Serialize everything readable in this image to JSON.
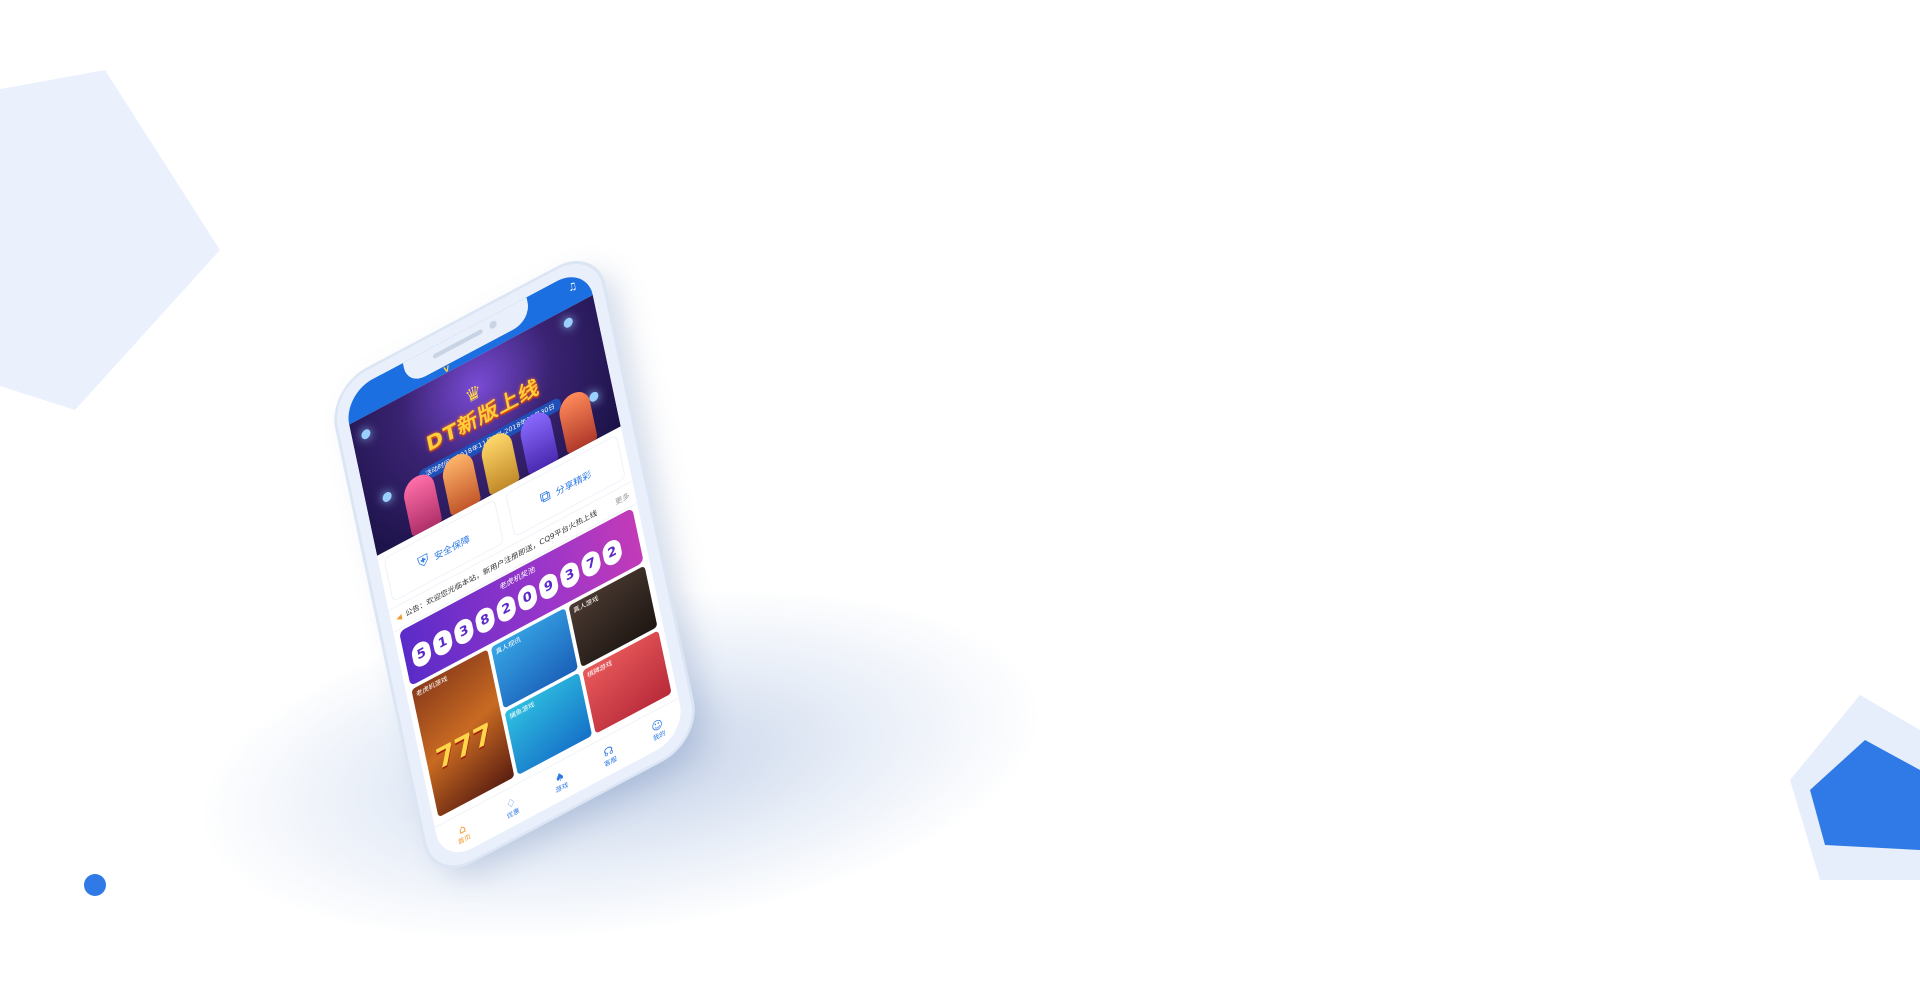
{
  "colors": {
    "accent": "#2f7ae6",
    "light_shape": "#e6eefc",
    "highlight": "#f29a2e"
  },
  "phone": {
    "header": {
      "logo_text": "V",
      "bell_icon": "bell-icon"
    },
    "banner": {
      "title": "DT新版上线",
      "subtitle": "活动时间：2018年11月1日-2018年11月30日",
      "crown_icon": "crown-icon"
    },
    "features": [
      {
        "label": "安全保障",
        "icon": "shield-icon"
      },
      {
        "label": "分享精彩",
        "icon": "share-icon"
      }
    ],
    "notice": {
      "text": "公告：欢迎您光临本站，新用户注册即送，CQ9平台火热上线",
      "more": "更多"
    },
    "jackpot": {
      "label": "老虎机奖池",
      "digits": [
        "5",
        "1",
        "3",
        "8",
        "2",
        "0",
        "9",
        "3",
        "7",
        "2"
      ]
    },
    "games": {
      "slot": "老虎机游戏",
      "live": "真人视讯",
      "real": "真人游戏",
      "fish": "捕鱼游戏",
      "chess": "棋牌游戏",
      "slot_symbol": "777"
    },
    "tabs": [
      {
        "label": "首页",
        "icon": "home-icon"
      },
      {
        "label": "优惠",
        "icon": "gift-icon"
      },
      {
        "label": "游戏",
        "icon": "game-icon"
      },
      {
        "label": "客服",
        "icon": "support-icon"
      },
      {
        "label": "我的",
        "icon": "user-icon"
      }
    ]
  }
}
